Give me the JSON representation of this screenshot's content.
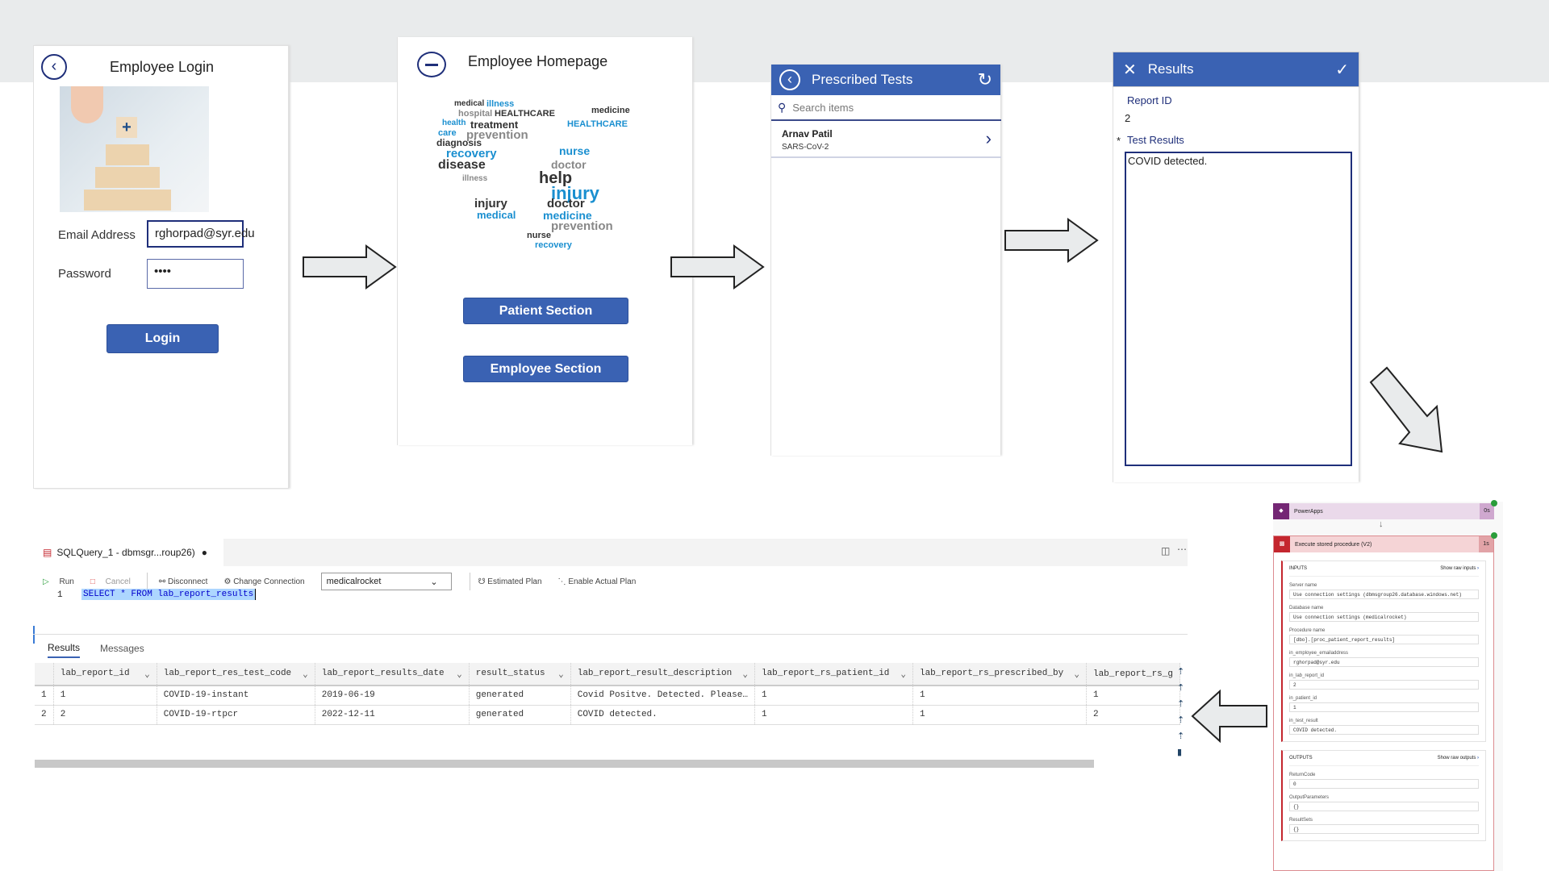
{
  "login": {
    "title": "Employee Login",
    "email_label": "Email Address",
    "email_value": "rghorpad@syr.edu",
    "password_label": "Password",
    "password_value": "••••",
    "login_button": "Login"
  },
  "homepage": {
    "title": "Employee Homepage",
    "patient_button": "Patient Section",
    "employee_button": "Employee Section",
    "wordcloud": [
      "medical",
      "illness",
      "hospital",
      "HEALTHCARE",
      "health",
      "treatment",
      "care",
      "prevention",
      "diagnosis",
      "recovery",
      "disease",
      "nurse",
      "doctor",
      "help",
      "injury",
      "medicine",
      "HEALTHCARE",
      "illness",
      "injury",
      "medical",
      "doctor",
      "medicine",
      "prevention",
      "nurse",
      "recovery"
    ]
  },
  "prescribed": {
    "title": "Prescribed Tests",
    "search_placeholder": "Search items",
    "items": [
      {
        "name": "Arnav Patil",
        "test": "SARS-CoV-2"
      }
    ]
  },
  "results": {
    "title": "Results",
    "report_id_label": "Report ID",
    "report_id_value": "2",
    "required_mark": "*",
    "test_results_label": "Test Results",
    "test_results_value": "COVID detected."
  },
  "sql": {
    "tab_title": "SQLQuery_1 - dbmsgr...roup26)",
    "run": "Run",
    "cancel": "Cancel",
    "disconnect": "Disconnect",
    "change_connection": "Change Connection",
    "database": "medicalrocket",
    "estimated_plan": "Estimated Plan",
    "enable_actual_plan": "Enable Actual Plan",
    "line_number": "1",
    "query": "SELECT * FROM lab_report_results",
    "tabs": [
      "Results",
      "Messages"
    ],
    "columns": [
      "lab_report_id",
      "lab_report_res_test_code",
      "lab_report_results_date",
      "result_status",
      "lab_report_result_description",
      "lab_report_rs_patient_id",
      "lab_report_rs_prescribed_by",
      "lab_report_rs_g"
    ],
    "rows": [
      [
        "1",
        "1",
        "COVID-19-instant",
        "2019-06-19",
        "generated",
        "Covid Positve. Detected. Please…",
        "1",
        "1",
        "1"
      ],
      [
        "2",
        "2",
        "COVID-19-rtpcr",
        "2022-12-11",
        "generated",
        "COVID detected.",
        "1",
        "1",
        "2"
      ]
    ]
  },
  "flow": {
    "trigger": "PowerApps",
    "trigger_time": "0s",
    "action": "Execute stored procedure (V2)",
    "action_time": "1s",
    "inputs_label": "INPUTS",
    "show_raw_inputs": "Show raw inputs",
    "outputs_label": "OUTPUTS",
    "show_raw_outputs": "Show raw outputs",
    "inputs": [
      {
        "label": "Server name",
        "value": "Use connection settings (dbmsgroup26.database.windows.net)"
      },
      {
        "label": "Database name",
        "value": "Use connection settings (medicalrocket)"
      },
      {
        "label": "Procedure name",
        "value": "[dbo].[proc_patient_report_results]"
      },
      {
        "label": "in_employee_emailaddress",
        "value": "rghorpad@syr.edu"
      },
      {
        "label": "in_lab_report_id",
        "value": "2"
      },
      {
        "label": "in_patient_id",
        "value": "1"
      },
      {
        "label": "in_test_result",
        "value": "COVID detected."
      }
    ],
    "outputs": [
      {
        "label": "ReturnCode",
        "value": "0"
      },
      {
        "label": "OutputParameters",
        "value": "{}"
      },
      {
        "label": "ResultSets",
        "value": "{}"
      }
    ]
  },
  "colors": {
    "accent": "#3a62b3",
    "nav_dark": "#1f2f7a",
    "flow_trigger": "#742774",
    "flow_action": "#c4262e",
    "selection": "#add6ff"
  }
}
